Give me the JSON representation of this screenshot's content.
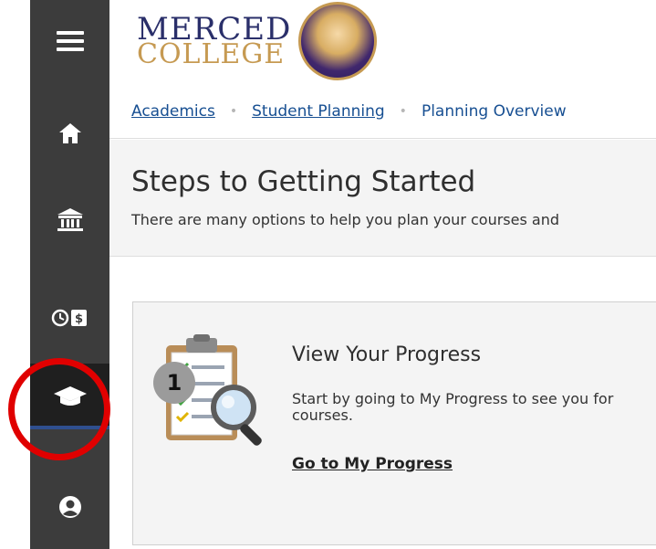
{
  "logo": {
    "line1": "MERCED",
    "line2": "COLLEGE"
  },
  "sidebar": {
    "items": [
      {
        "icon": "hamburger-menu-icon",
        "active": false
      },
      {
        "icon": "home-icon",
        "active": false
      },
      {
        "icon": "bank-icon",
        "active": false
      },
      {
        "icon": "clock-dollar-icon",
        "active": false
      },
      {
        "icon": "graduation-cap-icon",
        "active": true
      },
      {
        "icon": "user-circle-icon",
        "active": false
      }
    ]
  },
  "breadcrumb": {
    "items": [
      {
        "label": "Academics"
      },
      {
        "label": "Student Planning"
      },
      {
        "label": "Planning Overview"
      }
    ]
  },
  "header": {
    "title": "Steps to Getting Started",
    "subtitle": "There are many options to help you plan your courses and"
  },
  "step1": {
    "number": "1",
    "title": "View Your Progress",
    "description": "Start by going to My Progress to see you for courses.",
    "link_label": "Go to My Progress"
  },
  "colors": {
    "sidebar_bg": "#3c3c3c",
    "sidebar_active_bg": "#1f1f1f",
    "link_blue": "#174f92",
    "highlight_red": "#e00000",
    "brand_navy": "#2a2f6a",
    "brand_gold": "#c69a52"
  }
}
